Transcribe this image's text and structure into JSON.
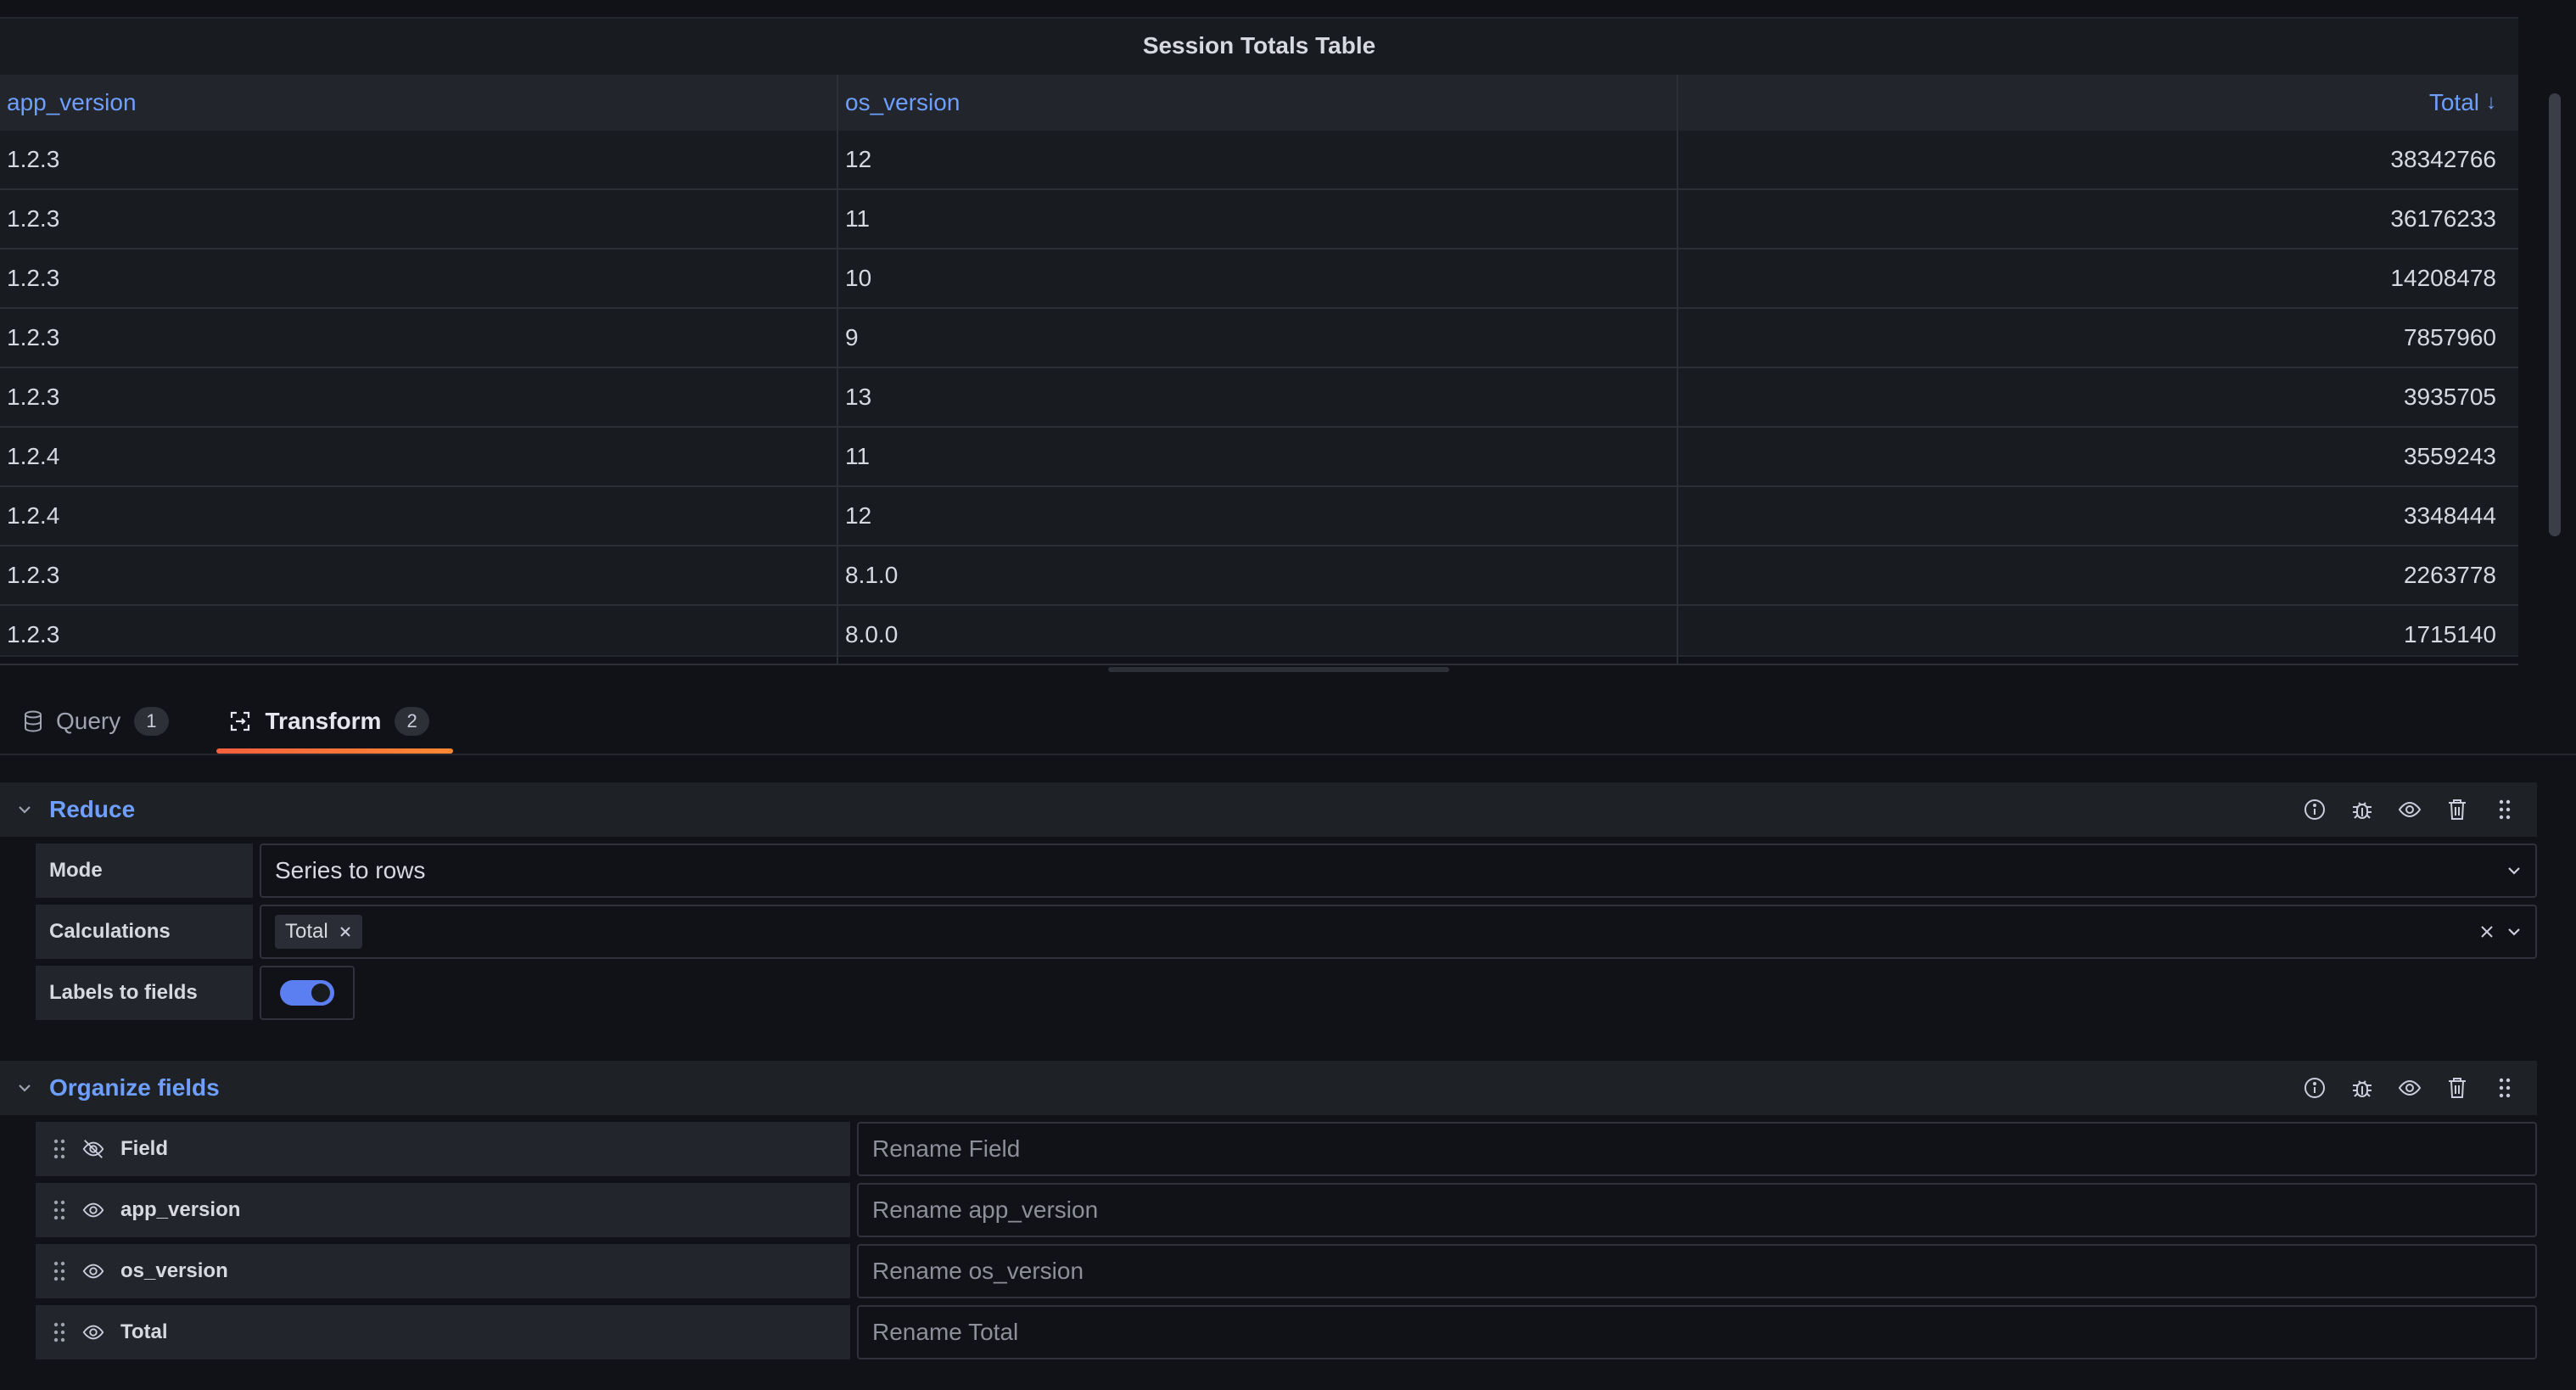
{
  "panel": {
    "title": "Session Totals Table",
    "columns": [
      "app_version",
      "os_version",
      "Total"
    ],
    "sort_indicator": "↓",
    "rows": [
      [
        "1.2.3",
        "12",
        "38342766"
      ],
      [
        "1.2.3",
        "11",
        "36176233"
      ],
      [
        "1.2.3",
        "10",
        "14208478"
      ],
      [
        "1.2.3",
        "9",
        "7857960"
      ],
      [
        "1.2.3",
        "13",
        "3935705"
      ],
      [
        "1.2.4",
        "11",
        "3559243"
      ],
      [
        "1.2.4",
        "12",
        "3348444"
      ],
      [
        "1.2.3",
        "8.1.0",
        "2263778"
      ],
      [
        "1.2.3",
        "8.0.0",
        "1715140"
      ]
    ]
  },
  "tabs": [
    {
      "label": "Query",
      "count": "1",
      "icon": "database-icon"
    },
    {
      "label": "Transform",
      "count": "2",
      "icon": "transform-icon",
      "active": true
    }
  ],
  "reduce": {
    "title": "Reduce",
    "mode_label": "Mode",
    "mode_value": "Series to rows",
    "calc_label": "Calculations",
    "calc_tag": "Total",
    "labels_label": "Labels to fields",
    "labels_enabled": true
  },
  "organize": {
    "title": "Organize fields",
    "fields": [
      {
        "name": "Field",
        "placeholder": "Rename Field",
        "visible": false
      },
      {
        "name": "app_version",
        "placeholder": "Rename app_version",
        "visible": true
      },
      {
        "name": "os_version",
        "placeholder": "Rename os_version",
        "visible": true
      },
      {
        "name": "Total",
        "placeholder": "Rename Total",
        "visible": true
      }
    ]
  },
  "colors": {
    "accent_blue": "#6e9fff",
    "tab_underline": "#ff8833",
    "toggle_on": "#5b7ff0"
  }
}
